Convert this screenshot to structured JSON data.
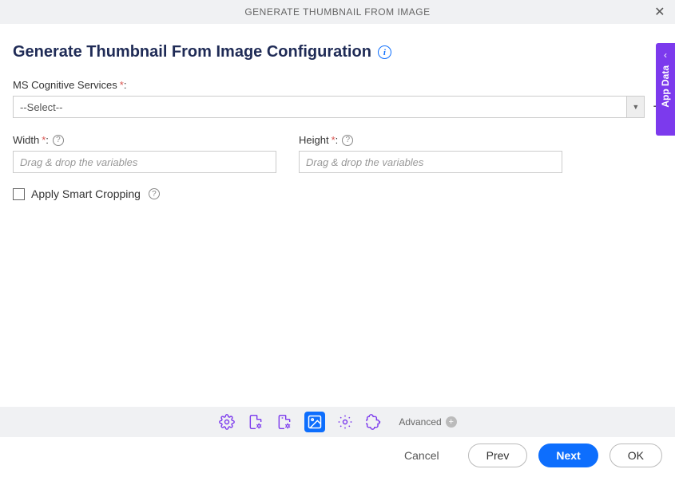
{
  "header": {
    "title": "GENERATE THUMBNAIL FROM IMAGE"
  },
  "page_title": "Generate Thumbnail From Image Configuration",
  "form": {
    "services_label": "MS Cognitive Services",
    "services_value": "--Select--",
    "width_label": "Width",
    "height_label": "Height",
    "width_placeholder": "Drag & drop the variables",
    "height_placeholder": "Drag & drop the variables",
    "smart_crop_label": "Apply Smart Cropping"
  },
  "side_tab": {
    "label": "App Data"
  },
  "toolbar": {
    "advanced_label": "Advanced"
  },
  "footer": {
    "cancel": "Cancel",
    "prev": "Prev",
    "next": "Next",
    "ok": "OK"
  }
}
